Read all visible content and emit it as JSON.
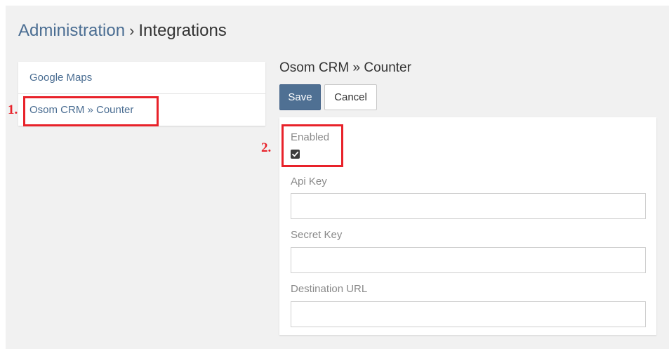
{
  "breadcrumb": {
    "root": "Administration",
    "separator": "›",
    "current": "Integrations"
  },
  "sidebar": {
    "items": [
      {
        "label": "Google Maps"
      },
      {
        "label": "Osom CRM » Counter"
      }
    ]
  },
  "panel": {
    "title": "Osom CRM » Counter",
    "save_label": "Save",
    "cancel_label": "Cancel"
  },
  "form": {
    "enabled": {
      "label": "Enabled",
      "checked": true
    },
    "api_key": {
      "label": "Api Key",
      "value": "",
      "placeholder": ""
    },
    "secret_key": {
      "label": "Secret Key",
      "value": "",
      "placeholder": ""
    },
    "destination_url": {
      "label": "Destination URL",
      "value": "",
      "placeholder": ""
    }
  },
  "annotations": [
    {
      "number": "1."
    },
    {
      "number": "2."
    }
  ],
  "colors": {
    "link": "#4a6d92",
    "primary_button": "#4f7093",
    "annotation": "#e8222a",
    "background": "#f1f1f1"
  }
}
